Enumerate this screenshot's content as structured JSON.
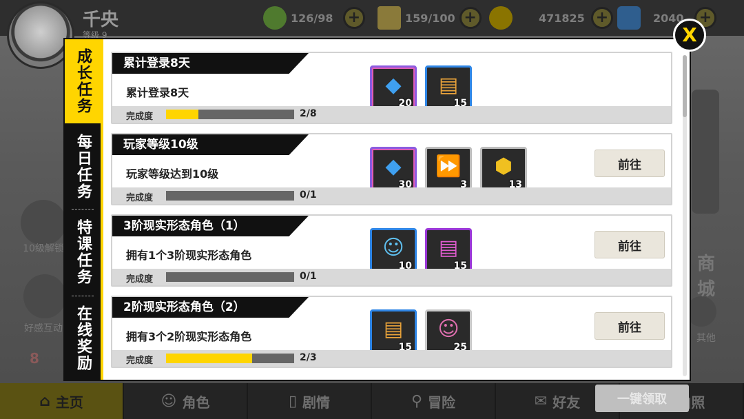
{
  "background": {
    "player_name": "千央",
    "player_level": "等级 9",
    "resources": [
      {
        "icon": "leaf-stamina-icon",
        "value": "126/98",
        "color": "#6aa83a"
      },
      {
        "icon": "ticket-energy-icon",
        "value": "159/100",
        "color": "#c8a23c"
      },
      {
        "icon": "coin-icon",
        "value": "471825",
        "color": "#c9a200"
      },
      {
        "icon": "diamond-icon",
        "value": "2040",
        "color": "#4a8fd6"
      }
    ],
    "side_left": [
      "10级解锁",
      "好感互动"
    ],
    "side_right": [
      "商城",
      "其他"
    ],
    "badge_count": "8",
    "nav": [
      {
        "icon": "home-icon",
        "label": "主页",
        "active": true
      },
      {
        "icon": "characters-icon",
        "label": "角色",
        "active": false
      },
      {
        "icon": "cards-icon",
        "label": "剧情",
        "active": false
      },
      {
        "icon": "location-pin-icon",
        "label": "冒险",
        "active": false
      },
      {
        "icon": "chat-bubble-icon",
        "label": "好友",
        "active": false
      },
      {
        "icon": "photo-icon",
        "label": "拍照",
        "active": false
      }
    ]
  },
  "dialog": {
    "tabs": [
      "成长任务",
      "每日任务",
      "特课任务",
      "在线奖励"
    ],
    "active_tab": 0,
    "close_label": "X",
    "claim_all_label": "一键领取",
    "progress_label": "完成度",
    "go_label": "前往",
    "tasks": [
      {
        "title": "累计登录8天",
        "desc": "累计登录8天",
        "progress": "2/8",
        "fraction": 0.25,
        "show_go": false,
        "rewards": [
          {
            "icon": "blue-cube-icon",
            "qty": "20",
            "frame": "rainbow"
          },
          {
            "icon": "ticket-card-icon",
            "qty": "15",
            "frame": "blue"
          }
        ]
      },
      {
        "title": "玩家等级10级",
        "desc": "玩家等级达到10级",
        "progress": "0/1",
        "fraction": 0,
        "show_go": true,
        "rewards": [
          {
            "icon": "blue-cube-icon",
            "qty": "30",
            "frame": "rainbow"
          },
          {
            "icon": "fast-forward-stopwatch-icon",
            "qty": "3",
            "frame": "gray"
          },
          {
            "icon": "exp-badge-icon",
            "qty": "13",
            "frame": "gray"
          }
        ]
      },
      {
        "title": "3阶现实形态角色（1）",
        "desc": "拥有1个3阶现实形态角色",
        "progress": "0/1",
        "fraction": 0,
        "show_go": true,
        "rewards": [
          {
            "icon": "smiley-stamp-icon",
            "qty": "10",
            "frame": "blue"
          },
          {
            "icon": "purple-tickets-icon",
            "qty": "15",
            "frame": "purple"
          }
        ]
      },
      {
        "title": "2阶现实形态角色（2）",
        "desc": "拥有3个2阶现实形态角色",
        "progress": "2/3",
        "fraction": 0.667,
        "show_go": true,
        "rewards": [
          {
            "icon": "ticket-card-icon",
            "qty": "15",
            "frame": "blue"
          },
          {
            "icon": "pink-stamp-icon",
            "qty": "25",
            "frame": "grayblue"
          }
        ]
      }
    ]
  }
}
